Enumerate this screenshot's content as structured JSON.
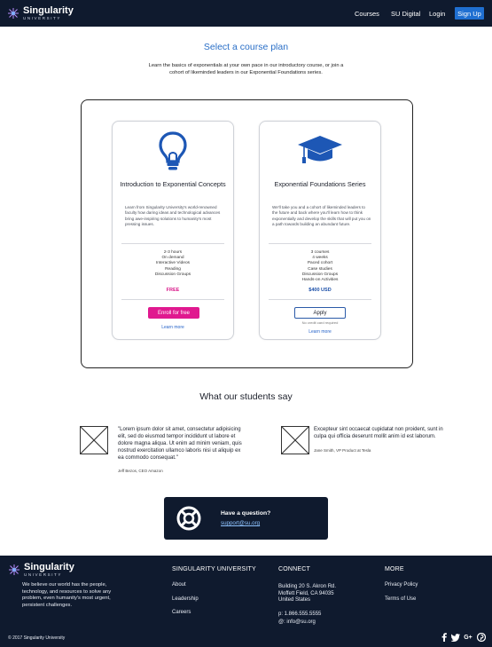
{
  "header": {
    "logo_name": "Singularity",
    "logo_sub": "UNIVERSITY",
    "nav": [
      {
        "label": "Courses"
      },
      {
        "label": "SU Digital"
      },
      {
        "label": "Login"
      }
    ],
    "signup_label": "Sign Up"
  },
  "main": {
    "title": "Select a course plan",
    "intro": "Learn the basics of exponentials at your own pace in our introductory course, or join a cohort of likeminded leaders in our Exponential Foundations series.",
    "cards": [
      {
        "icon": "lightbulb-icon",
        "title": "Introduction to Exponential Concepts",
        "description": "Learn from Singularity University's world-renowned faculty how daring ideas and technological advances bring awe-inspiring solutions to humanity's most pressing issues.",
        "features": [
          "2-3 hours",
          "On demand",
          "Interactive Videos",
          "Reading",
          "Discussion Groups"
        ],
        "price": "FREE",
        "button_label": "Enroll for free",
        "learn_more": "Learn more"
      },
      {
        "icon": "graduation-cap-icon",
        "title": "Exponential Foundations Series",
        "description": "We'll take you and a cohort of likeminded leaders to the future and back where you'll learn how to think exponentially and develop the skills that will put you on a path towards building an abundant future.",
        "features": [
          "3 courses",
          "4 weeks",
          "Paced cohort",
          "Case studies",
          "Discussion Groups",
          "Hands-on Activities"
        ],
        "price": "$400 USD",
        "button_label": "Apply",
        "note": "No credit card required",
        "learn_more": "Learn more"
      }
    ],
    "testimonials_title": "What our students say",
    "testimonials": [
      {
        "quote": "\"Lorem ipsum dolor sit amet, consectetur adipisicing elit, sed do eiusmod tempor incididunt ut labore et dolore magna aliqua. Ut enim ad minim veniam, quis nostrud exercitation ullamco laboris nisi ut aliquip ex ea commodo consequat.\"",
        "author": "Jeff Bezos, CEO Amazon"
      },
      {
        "quote": "Excepteur sint occaecat cupidatat non proident, sunt in culpa qui officia deserunt mollit anim id est laborum.",
        "author": "Jane Smith, VP Product at Tesla"
      }
    ],
    "help": {
      "question": "Have a question?",
      "email": "support@su.org"
    }
  },
  "footer": {
    "logo_name": "Singularity",
    "logo_sub": "UNIVERSITY",
    "tagline": "We believe our world has the people, technology, and resources to solve any problem, even humanity's most urgent, persistent challenges.",
    "columns": [
      {
        "heading": "SINGULARITY UNIVERSITY",
        "links": [
          "About",
          "Leadership",
          "Careers"
        ]
      },
      {
        "heading": "CONNECT"
      },
      {
        "heading": "MORE",
        "links": [
          "Privacy Policy",
          "Terms of Use"
        ]
      }
    ],
    "address": [
      "Building 20 S. Akron Rd.",
      "Moffett Field, CA 94035",
      "United States"
    ],
    "phone": "p: 1.866.555.5555",
    "email": "@: info@su.org",
    "copyright": "© 2017 Singularity University",
    "social": [
      "facebook-icon",
      "twitter-icon",
      "google-plus-icon",
      "pinterest-icon"
    ]
  },
  "colors": {
    "navy": "#0f1a2e",
    "brand_blue": "#2a6fc7",
    "signup_blue": "#1f6fd1",
    "magenta": "#e0198f"
  }
}
